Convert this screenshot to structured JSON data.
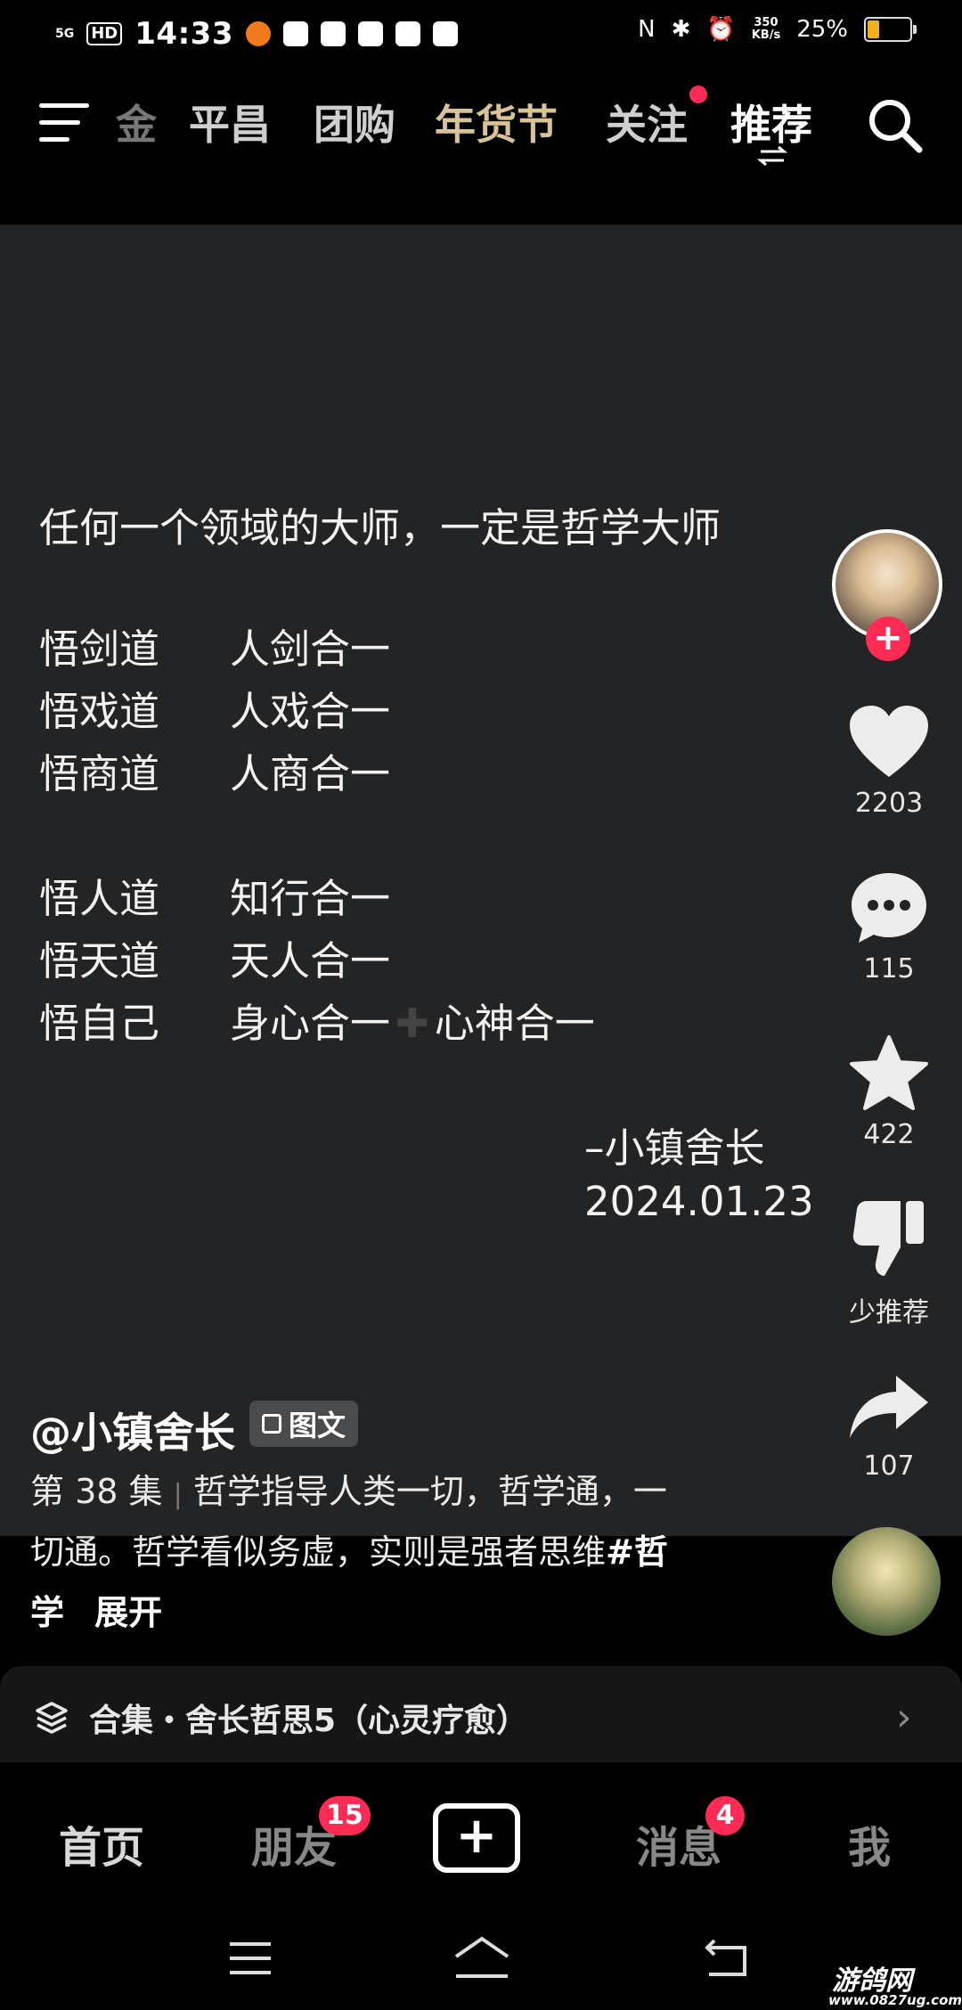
{
  "status_bar": {
    "network": "5G",
    "hd": "HD",
    "time": "14:33",
    "speed_value": "350",
    "speed_unit": "KB/s",
    "battery": "25%",
    "battery_level": 0.25
  },
  "top_nav": {
    "tabs": [
      "金",
      "平昌",
      "团购",
      "年货节",
      "关注",
      "推荐"
    ],
    "active_tab": "推荐"
  },
  "post": {
    "lines": [
      "任何一个领域的大师，一定是哲学大师",
      "悟剑道",
      "人剑合一",
      "悟戏道",
      "人戏合一",
      "悟商道",
      "人商合一",
      "悟人道",
      "知行合一",
      "悟天道",
      "天人合一",
      "悟自己",
      "身心合一",
      "心神合一"
    ],
    "signature": "–小镇舍长",
    "date": "2024.01.23"
  },
  "actions": {
    "like_count": "2203",
    "comment_count": "115",
    "favorite_count": "422",
    "dislike_label": "少推荐",
    "share_count": "107"
  },
  "author": {
    "handle": "@小镇舍长",
    "tag": "图文"
  },
  "description": {
    "episode": "第 38 集",
    "separator": "|",
    "line1": "哲学指导人类一切，哲学通，一",
    "line2_text": "切通。哲学看似务虚，实则是强者思维",
    "hashtag_part1": "#哲",
    "hashtag_part2": "学",
    "expand": "展开"
  },
  "collection": {
    "label": "合集・舍长哲思5（心灵疗愈）"
  },
  "bottom_nav": {
    "home": "首页",
    "friends": "朋友",
    "friends_badge": "15",
    "messages": "消息",
    "messages_badge": "4",
    "me": "我"
  },
  "watermark": {
    "name": "游鸽网",
    "url": "www.0827ug.com"
  }
}
